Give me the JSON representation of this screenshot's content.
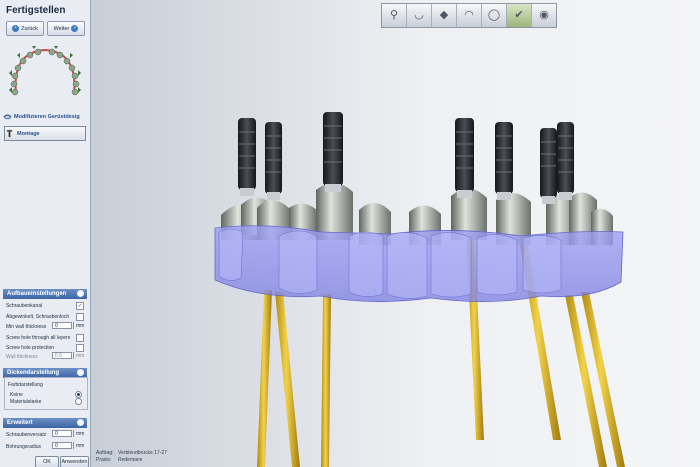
{
  "sidebar": {
    "title": "Fertigstellen",
    "nav": {
      "back_label": "Zurück",
      "forward_label": "Weiter"
    },
    "steps": [
      {
        "label": "Modifizieren Gerüstdesig"
      },
      {
        "label": "Montage"
      }
    ],
    "aufbau": {
      "header": "Aufbaueinstellungen",
      "rows": [
        {
          "label": "Schraubenkanal",
          "checked": "✓"
        },
        {
          "label": "Abgewinkelt, Schraubenloch",
          "checked": ""
        },
        {
          "label": "Min wall thickness",
          "value": "0",
          "unit": "mm"
        },
        {
          "label": "Screw hole through all layers",
          "checked": ""
        },
        {
          "label": "Screw hole protection",
          "checked": ""
        },
        {
          "label": "Wall thickness",
          "value": "0.5",
          "unit": "mm"
        }
      ]
    },
    "dicke": {
      "header": "Dickendarstellung",
      "group_label": "Farbdarstellung",
      "options": [
        {
          "label": "Keine",
          "selected": true
        },
        {
          "label": "Materialstarke",
          "selected": false
        }
      ]
    },
    "erweitert": {
      "header": "Erweitert",
      "rows": [
        {
          "label": "Schraubenversatz",
          "value": "0",
          "unit": "mm"
        },
        {
          "label": "Bohrungsradius",
          "value": "0",
          "unit": "mm"
        }
      ]
    },
    "ok_label": "OK",
    "apply_label": "Anwenden"
  },
  "toolbar": {
    "buttons": [
      {
        "name": "implant-view-icon",
        "glyph": "⚲",
        "active": false
      },
      {
        "name": "tooth-shape-icon",
        "glyph": "◡",
        "active": false
      },
      {
        "name": "tooth-dark-icon",
        "glyph": "◆",
        "active": false
      },
      {
        "name": "tooth-crown-icon",
        "glyph": "◠",
        "active": false
      },
      {
        "name": "tooth-outline-icon",
        "glyph": "◯",
        "active": false
      },
      {
        "name": "tooth-check-icon",
        "glyph": "✔",
        "active": true
      },
      {
        "name": "disc-icon",
        "glyph": "◉",
        "active": false
      }
    ]
  },
  "status": {
    "auftrag_label": "Auftrag:",
    "auftrag_value": "Verblendbrücke 17-27",
    "praxis_label": "Praxis:",
    "praxis_value": "Redemann"
  },
  "colors": {
    "section_header": "#3c65a6",
    "bridge_translucent": "#8d8ff0",
    "screw_shaft": "#e8c02a",
    "implant_body": "#2a2d33"
  }
}
